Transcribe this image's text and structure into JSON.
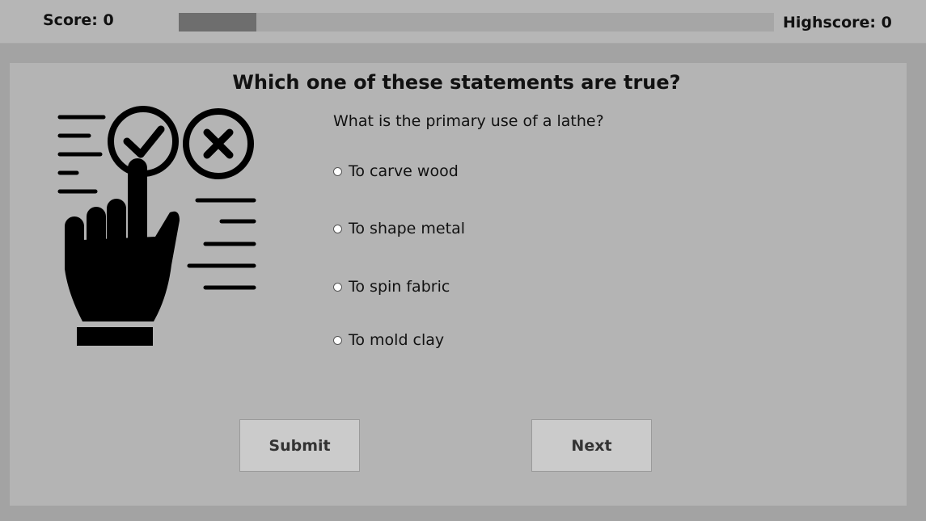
{
  "header": {
    "score_label": "Score: 0",
    "highscore_label": "Highscore: 0",
    "progress_fraction": 0.13
  },
  "quiz": {
    "title": "Which one of these statements are true?",
    "illustration_icon": "hand-selecting-checkmark-icon",
    "question": "What is the primary use of a lathe?",
    "options": [
      {
        "label": "To carve wood"
      },
      {
        "label": "To shape metal"
      },
      {
        "label": "To spin fabric"
      },
      {
        "label": "To mold clay"
      }
    ],
    "submit_label": "Submit",
    "next_label": "Next"
  }
}
